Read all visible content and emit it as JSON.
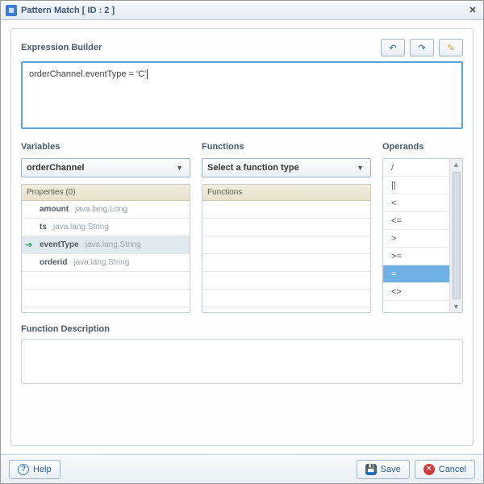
{
  "window": {
    "title": "Pattern Match [ ID : 2 ]"
  },
  "header": {
    "expression_label": "Expression Builder",
    "buttons": {
      "undo": "↶",
      "redo": "↷",
      "edit": "✎"
    }
  },
  "expression": {
    "text": "orderChannel.eventType = 'C'"
  },
  "variables": {
    "label": "Variables",
    "selected": "orderChannel",
    "panel_head": "Properties (0)",
    "rows": [
      {
        "name": "amount",
        "type": "java.lang.Long",
        "selected": false
      },
      {
        "name": "ts",
        "type": "java.lang.String",
        "selected": false
      },
      {
        "name": "eventType",
        "type": "java.lang.String",
        "selected": true
      },
      {
        "name": "orderid",
        "type": "java.lang.String",
        "selected": false
      }
    ]
  },
  "functions": {
    "label": "Functions",
    "selected": "Select a function type",
    "panel_head": "Functions"
  },
  "operands": {
    "label": "Operands",
    "items": [
      "/",
      "||",
      "<",
      "<=",
      ">",
      ">=",
      "=",
      "<>"
    ],
    "selected_index": 6
  },
  "function_description": {
    "label": "Function Description"
  },
  "footer": {
    "help": "Help",
    "save": "Save",
    "cancel": "Cancel"
  }
}
